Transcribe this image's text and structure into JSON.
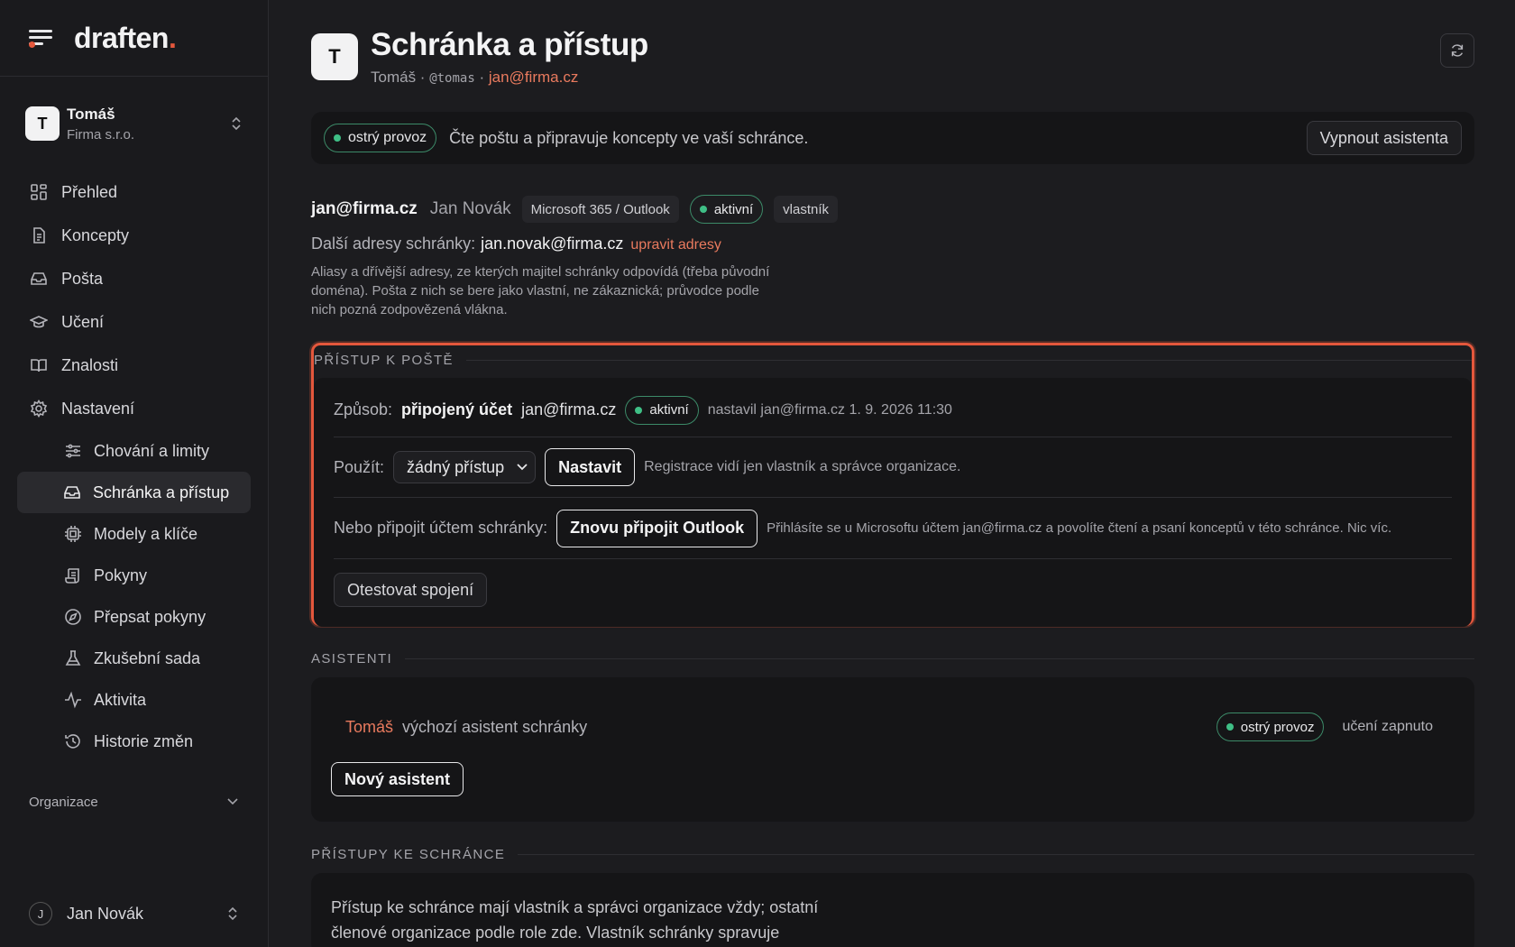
{
  "brand": {
    "name": "draften",
    "dot": "."
  },
  "workspace": {
    "avatar": "T",
    "name": "Tomáš",
    "company": "Firma s.r.o."
  },
  "nav": {
    "items": [
      {
        "label": "Přehled",
        "icon": "grid-icon"
      },
      {
        "label": "Koncepty",
        "icon": "document-icon"
      },
      {
        "label": "Pošta",
        "icon": "inbox-icon"
      },
      {
        "label": "Učení",
        "icon": "graduation-cap-icon"
      },
      {
        "label": "Znalosti",
        "icon": "book-icon"
      },
      {
        "label": "Nastavení",
        "icon": "gear-icon"
      }
    ],
    "sub": [
      {
        "label": "Chování a limity",
        "icon": "sliders-icon"
      },
      {
        "label": "Schránka a přístup",
        "icon": "inbox-icon",
        "active": true
      },
      {
        "label": "Modely a klíče",
        "icon": "chip-icon"
      },
      {
        "label": "Pokyny",
        "icon": "scroll-icon"
      },
      {
        "label": "Přepsat pokyny",
        "icon": "compass-icon"
      },
      {
        "label": "Zkušební sada",
        "icon": "flask-icon"
      },
      {
        "label": "Aktivita",
        "icon": "activity-icon"
      },
      {
        "label": "Historie změn",
        "icon": "history-icon"
      }
    ],
    "org_label": "Organizace"
  },
  "user": {
    "avatar": "J",
    "name": "Jan Novák"
  },
  "header": {
    "avatar": "T",
    "title": "Schránka a přístup",
    "sub_name": "Tomáš",
    "sub_sep": " · ",
    "sub_handle": "@tomas",
    "sub_email": "jan@firma.cz"
  },
  "banner": {
    "status": "ostrý provoz",
    "text": "Čte poštu a připravuje koncepty ve vaší schránce.",
    "button": "Vypnout asistenta"
  },
  "account": {
    "email": "jan@firma.cz",
    "name": "Jan Novák",
    "provider": "Microsoft 365 / Outlook",
    "status": "aktivní",
    "role": "vlastník",
    "alias_label": "Další adresy schránky:",
    "alias_value": "jan.novak@firma.cz",
    "alias_edit": "upravit adresy",
    "alias_help": "Aliasy a dřívější adresy, ze kterých majitel schránky odpovídá (třeba původní doména). Pošta z nich se bere jako vlastní, ne zákaznická; průvodce podle nich pozná zodpovězená vlákna."
  },
  "access": {
    "section": "PŘÍSTUP K POŠTĚ",
    "method_label": "Způsob:",
    "method_value": "připojený účet",
    "method_email": "jan@firma.cz",
    "method_status": "aktivní",
    "method_meta": "nastavil jan@firma.cz 1. 9. 2026 11:30",
    "use_label": "Použít:",
    "use_value": "žádný přístup",
    "use_button": "Nastavit",
    "use_help": "Registrace vidí jen vlastník a správce organizace.",
    "connect_label": "Nebo připojit účtem schránky:",
    "connect_button": "Znovu připojit Outlook",
    "connect_help": "Přihlásíte se u Microsoftu účtem jan@firma.cz a povolíte čtení a psaní konceptů v této schránce. Nic víc.",
    "test_button": "Otestovat spojení"
  },
  "assistants": {
    "section": "ASISTENTI",
    "items": [
      {
        "name": "Tomáš",
        "desc": "výchozí asistent schránky",
        "status": "ostrý provoz",
        "learning": "učení zapnuto"
      }
    ],
    "new_button": "Nový asistent"
  },
  "mailbox_access": {
    "section": "PŘÍSTUPY KE SCHRÁNCE",
    "text": "Přístup ke schránce mají vlastník a správci organizace vždy; ostatní členové organizace podle role zde. Vlastník schránky spravuje"
  },
  "colors": {
    "accent": "#e4573c",
    "link": "#e97a5e",
    "ok": "#3fbf86"
  }
}
